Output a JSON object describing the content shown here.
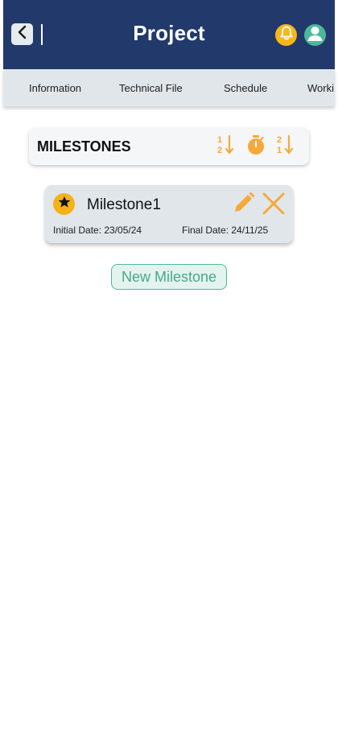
{
  "header": {
    "title": "Project",
    "back_icon": "chevron-left-icon",
    "notification_icon": "bell-icon",
    "profile_icon": "user-icon"
  },
  "tabs": [
    {
      "label": "Information"
    },
    {
      "label": "Technical File"
    },
    {
      "label": "Schedule"
    },
    {
      "label": "Worki"
    }
  ],
  "milestones_panel": {
    "title": "MILESTONES",
    "actions": [
      {
        "icon": "sort-ascending-icon"
      },
      {
        "icon": "timer-icon"
      },
      {
        "icon": "sort-descending-icon"
      }
    ]
  },
  "milestones": [
    {
      "name": "Milestone1",
      "initial_date": "Initial Date: 23/05/24",
      "final_date": "Final Date: 24/11/25",
      "icon": "star-icon"
    }
  ],
  "new_button": {
    "label": "New Milestone"
  },
  "colors": {
    "header_bg": "#213a6b",
    "tab_bg": "#e1e6ea",
    "accent_yellow": "#f5b117",
    "accent_green": "#4db89a",
    "action_orange": "#f6a93a"
  }
}
